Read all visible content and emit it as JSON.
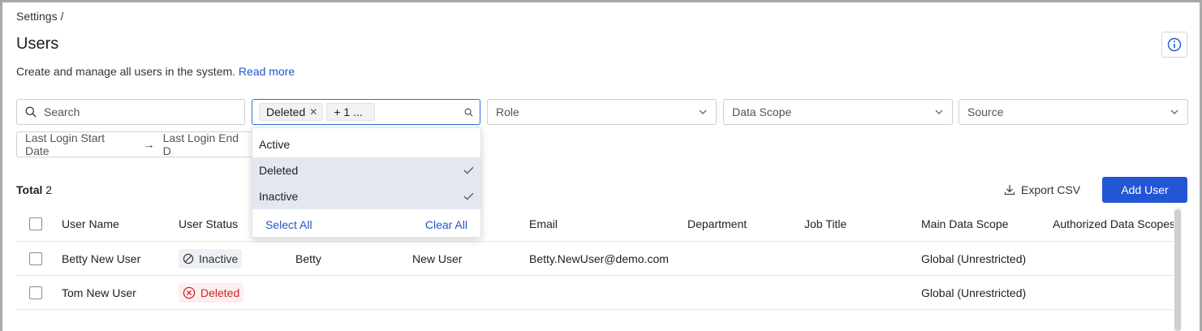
{
  "breadcrumb": "Settings /",
  "page": {
    "title": "Users",
    "description": "Create and manage all users in the system.",
    "read_more": "Read more"
  },
  "filters": {
    "search_placeholder": "Search",
    "status_tags": [
      "Deleted",
      "+ 1 ..."
    ],
    "role_placeholder": "Role",
    "data_scope_placeholder": "Data Scope",
    "source_placeholder": "Source",
    "login_start_placeholder": "Last Login Start Date",
    "login_end_placeholder": "Last Login End D"
  },
  "status_dropdown": {
    "options": [
      {
        "label": "Active",
        "selected": false
      },
      {
        "label": "Deleted",
        "selected": true
      },
      {
        "label": "Inactive",
        "selected": true
      }
    ],
    "select_all": "Select All",
    "clear_all": "Clear All"
  },
  "toolbar": {
    "total_label": "Total",
    "total_count": "2",
    "export_label": "Export CSV",
    "add_user_label": "Add User"
  },
  "table": {
    "columns": [
      "User Name",
      "User Status",
      "Email",
      "Department",
      "Job Title",
      "Main Data Scope",
      "Authorized Data Scopes"
    ],
    "rows": [
      {
        "user_name": "Betty New User",
        "status": "Inactive",
        "first_name": "Betty",
        "last_name": "New User",
        "email": "Betty.NewUser@demo.com",
        "main_scope": "Global (Unrestricted)"
      },
      {
        "user_name": "Tom New User",
        "status": "Deleted",
        "first_name": "",
        "last_name": "",
        "email": "",
        "main_scope": "Global (Unrestricted)"
      }
    ]
  },
  "colors": {
    "primary": "#2356d4",
    "link": "#1f56c8",
    "deleted": "#d0262a",
    "selected_option_bg": "#e4e7ef"
  },
  "icons": [
    "info-icon",
    "search-icon",
    "chevron-down-icon",
    "close-icon",
    "check-icon",
    "download-icon",
    "inactive-icon",
    "deleted-icon",
    "arrow-right-icon"
  ]
}
